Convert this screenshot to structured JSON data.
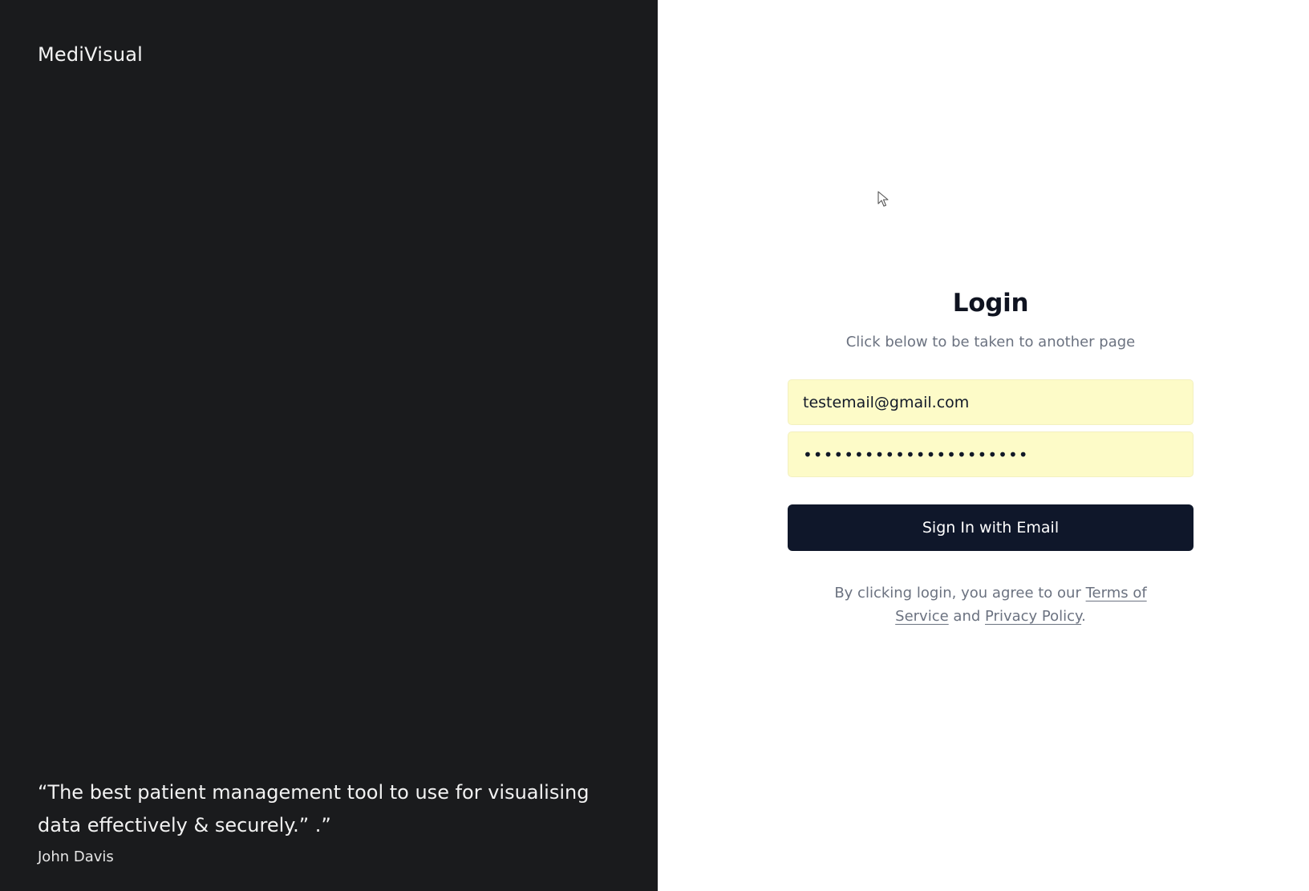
{
  "brand": {
    "name": "MediVisual"
  },
  "testimonial": {
    "quote": "“The best patient management tool to use for visualising data effectively & securely.” .”",
    "author": "John Davis"
  },
  "login": {
    "title": "Login",
    "subtitle": "Click below to be taken to another page",
    "email_value": "testemail@gmail.com",
    "password_value": "••••••••••••••••••••••",
    "submit_label": "Sign In with Email",
    "legal_prefix": "By clicking login, you agree to our ",
    "terms_label": "Terms of Service",
    "legal_and": " and ",
    "privacy_label": "Privacy Policy",
    "legal_suffix": "."
  },
  "colors": {
    "left_panel_bg": "#1a1b1d",
    "button_bg": "#0f172a",
    "autofill_bg": "#fdfbc8"
  },
  "icons": {
    "cursor": "mouse-pointer-icon"
  }
}
